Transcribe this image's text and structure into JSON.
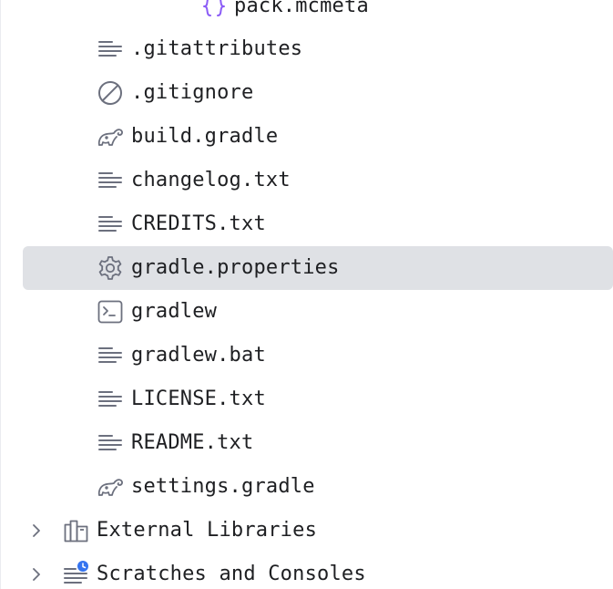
{
  "project_tree": {
    "items": [
      {
        "label": "pack.mcmeta",
        "icon": "json-braces-icon",
        "icon_color": "#8b5cf6"
      },
      {
        "label": ".gitattributes",
        "icon": "text-file-icon"
      },
      {
        "label": ".gitignore",
        "icon": "ignore-file-icon"
      },
      {
        "label": "build.gradle",
        "icon": "gradle-elephant-icon"
      },
      {
        "label": "changelog.txt",
        "icon": "text-file-icon"
      },
      {
        "label": "CREDITS.txt",
        "icon": "text-file-icon"
      },
      {
        "label": "gradle.properties",
        "icon": "gear-icon",
        "selected": true
      },
      {
        "label": "gradlew",
        "icon": "terminal-icon"
      },
      {
        "label": "gradlew.bat",
        "icon": "text-file-icon"
      },
      {
        "label": "LICENSE.txt",
        "icon": "text-file-icon"
      },
      {
        "label": "README.txt",
        "icon": "text-file-icon"
      },
      {
        "label": "settings.gradle",
        "icon": "gradle-elephant-icon"
      },
      {
        "label": "External Libraries",
        "icon": "library-icon",
        "collapsed": true
      },
      {
        "label": "Scratches and Consoles",
        "icon": "scratches-icon",
        "collapsed": true,
        "badge_color": "#3574f0"
      }
    ]
  },
  "colors": {
    "selection": "#dfe1e5",
    "icon_gray": "#6c707e",
    "text": "#1e1f22"
  }
}
